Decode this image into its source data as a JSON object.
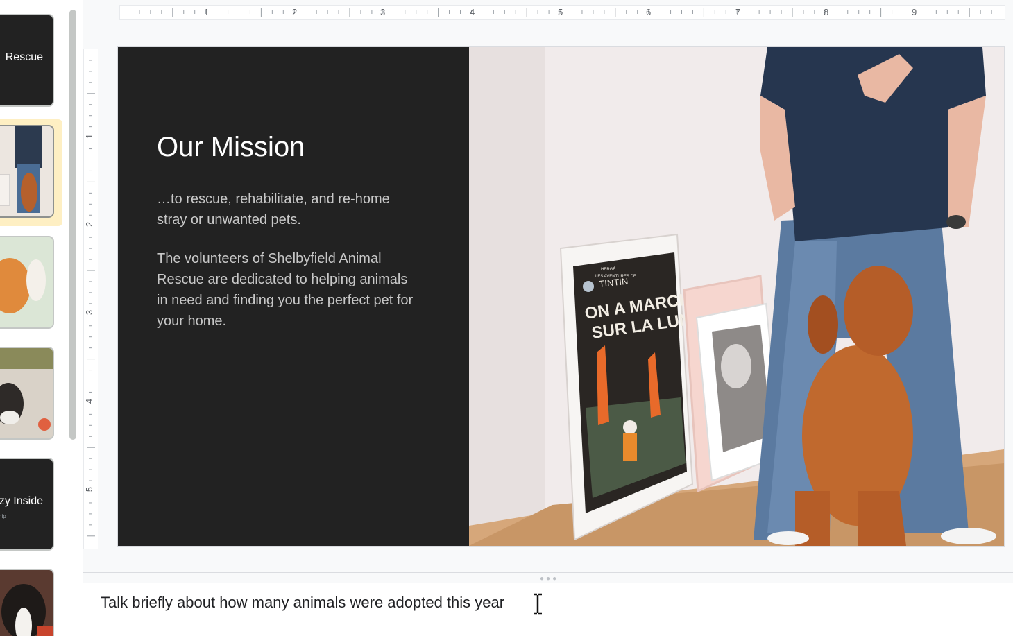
{
  "filmstrip": {
    "slides": [
      {
        "title": "Rescue",
        "subtitle": ""
      },
      {
        "title": "",
        "subtitle": ""
      },
      {
        "title": "",
        "subtitle": ""
      },
      {
        "title": "",
        "subtitle": ""
      },
      {
        "title": "zy Inside",
        "subtitle": "ship"
      },
      {
        "title": "",
        "subtitle": ""
      }
    ],
    "selected_index": 1
  },
  "ruler": {
    "horizontal": [
      "1",
      "2",
      "3",
      "4",
      "5",
      "6",
      "7",
      "8",
      "9"
    ],
    "vertical": [
      "1",
      "2",
      "3",
      "4",
      "5"
    ]
  },
  "slide": {
    "title": "Our Mission",
    "paragraph1": "…to rescue, rehabilitate, and re-home stray or unwanted pets.",
    "paragraph2": "The volunteers of Shelbyfield Animal Rescue are dedicated to helping animals in need and finding you the perfect pet for your home.",
    "poster": {
      "line1": "HERGÉ",
      "line2": "LES AVENTURES DE",
      "line3": "TINTIN",
      "line4": "ON A MARCHÉ",
      "line5": "SUR LA LUNE"
    }
  },
  "notes": {
    "text": "Talk briefly about how many animals were adopted this year"
  },
  "colors": {
    "slide_background": "#222222",
    "selection_highlight": "#feefc3"
  }
}
